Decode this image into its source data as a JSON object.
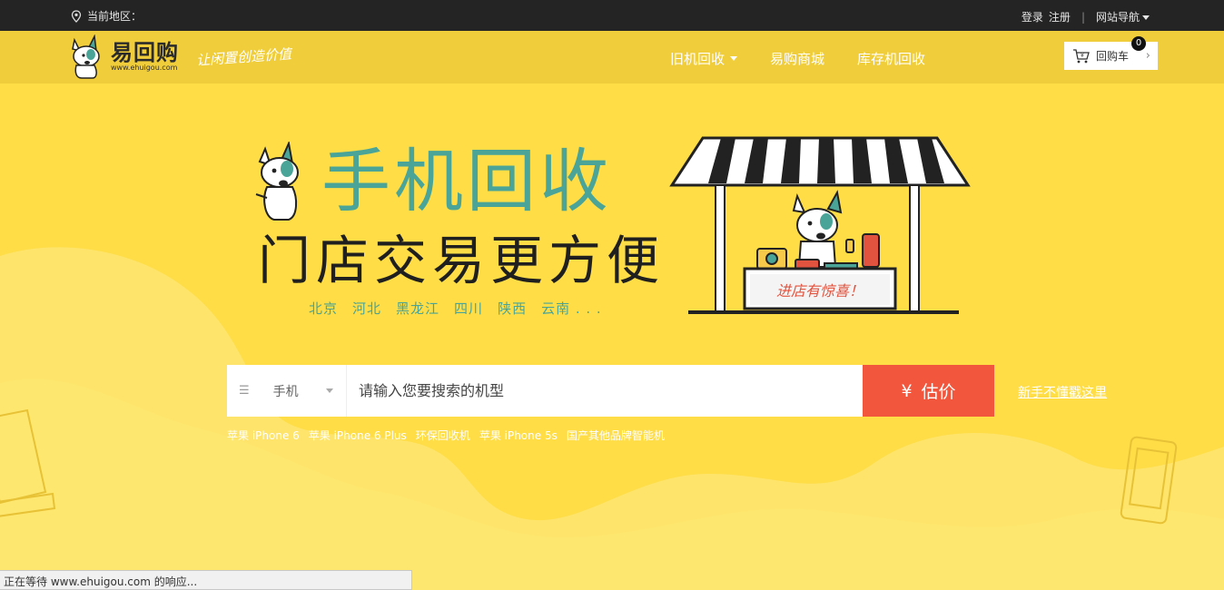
{
  "topbar": {
    "region_label": "当前地区：",
    "login": "登录",
    "register": "注册",
    "site_nav": "网站导航"
  },
  "header": {
    "logo_cn": "易回购",
    "logo_en": "www.ehuigou.com",
    "slogan": "让闲置创造价值",
    "nav": [
      "旧机回收",
      "易购商城",
      "库存机回收"
    ],
    "cart_label": "回购车",
    "cart_count": "0"
  },
  "hero": {
    "title1": "手机回收",
    "title2": "门店交易更方便",
    "cities": [
      "北京",
      "河北",
      "黑龙江",
      "四川",
      "陕西",
      "云南 . . ."
    ],
    "booth_sign": "进店有惊喜！"
  },
  "search": {
    "category": "手机",
    "placeholder": "请输入您要搜索的机型",
    "button_symbol": "¥",
    "button_label": "估价",
    "newbie_link": "新手不懂戳这里",
    "hot": [
      "苹果 iPhone 6",
      "苹果 iPhone 6 Plus",
      "环保回收机",
      "苹果 iPhone 5s",
      "国产其他品牌智能机"
    ]
  },
  "status_bar": "正在等待 www.ehuigou.com 的响应...",
  "colors": {
    "background": "#fedd47",
    "header": "#f0cd3a",
    "teal": "#4aa598",
    "button": "#f2563d"
  }
}
